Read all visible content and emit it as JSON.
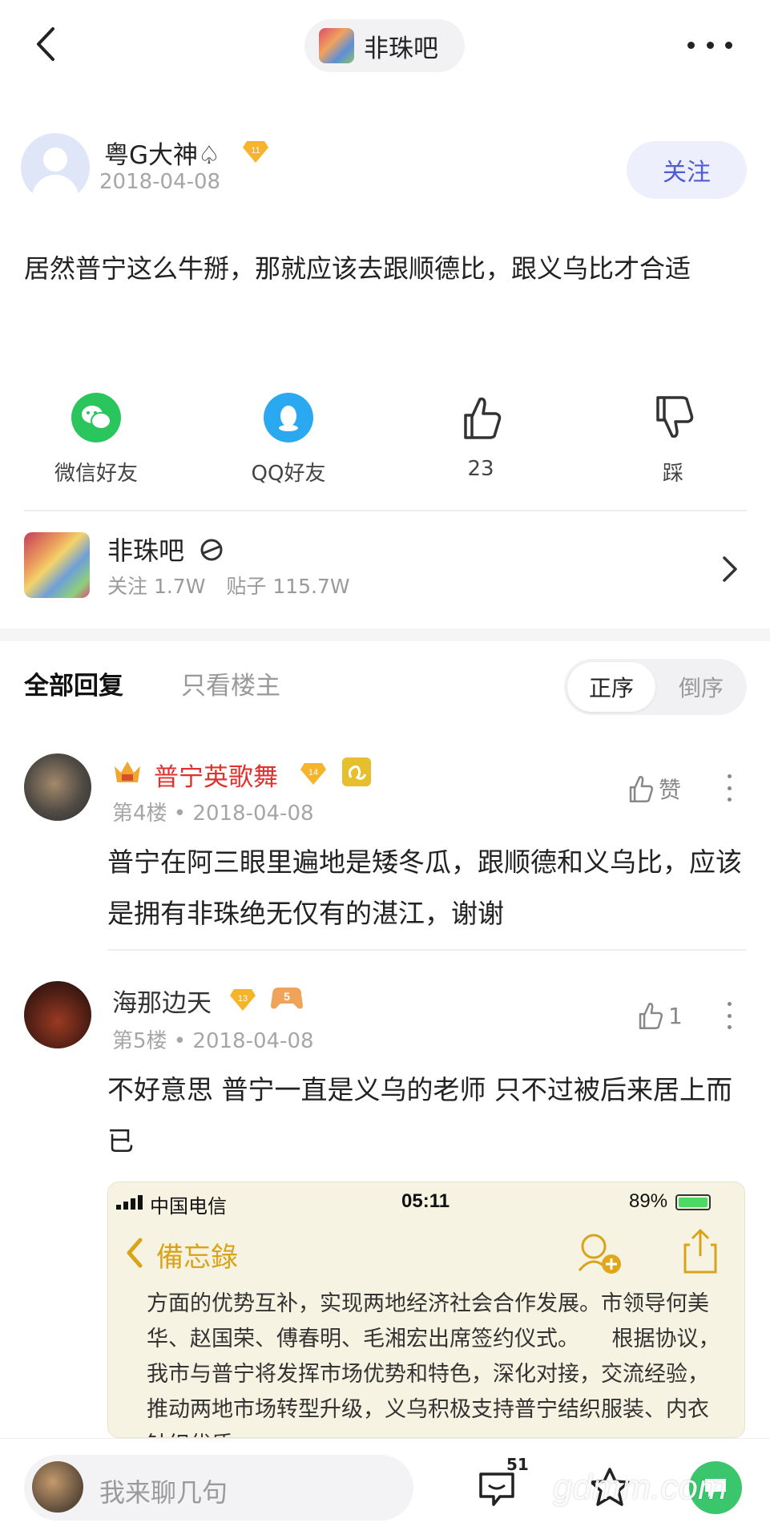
{
  "header": {
    "forum_name": "非珠吧"
  },
  "post": {
    "author": "粤G大神♤",
    "author_level": "11",
    "date": "2018-04-08",
    "follow_label": "关注",
    "text": "居然普宁这么牛掰，那就应该去跟顺德比，跟义乌比才合适",
    "share": {
      "wechat": "微信好友",
      "qq": "QQ好友"
    },
    "likes": "23",
    "dislike_label": "踩"
  },
  "forum_card": {
    "name": "非珠吧",
    "followers": "关注 1.7W",
    "posts": "贴子 115.7W"
  },
  "reply_tabs": {
    "all": "全部回复",
    "op_only": "只看楼主",
    "sort_asc": "正序",
    "sort_desc": "倒序"
  },
  "replies": [
    {
      "name": "普宁英歌舞",
      "name_color": "#e0312f",
      "level": "14",
      "floor": "第4楼",
      "date": "2018-04-08",
      "like_label": "赞",
      "text": "普宁在阿三眼里遍地是矮冬瓜，跟顺德和义乌比，应该是拥有非珠绝无仅有的湛江，谢谢"
    },
    {
      "name": "海那边天",
      "name_color": "#333333",
      "level": "13",
      "badge": "5",
      "floor": "第5楼",
      "date": "2018-04-08",
      "like_count": "1",
      "text": "不好意思 普宁一直是义乌的老师 只不过被后来居上而已"
    }
  ],
  "embedded_screenshot": {
    "carrier": "中国电信",
    "time": "05:11",
    "battery": "89%",
    "title": "備忘錄",
    "body": "方面的优势互补，实现两地经济社会合作发展。市领导何美华、赵国荣、傅春明、毛湘宏出席签约仪式。　　根据协议，我市与普宁将发挥市场优势和特色，深化对接，交流经验，推动两地市场转型升级，义乌积极支持普宁结织服装、内衣针织优质"
  },
  "bottom_bar": {
    "placeholder": "我来聊几句",
    "comment_count": "51",
    "watermark": "gdmm.com"
  }
}
